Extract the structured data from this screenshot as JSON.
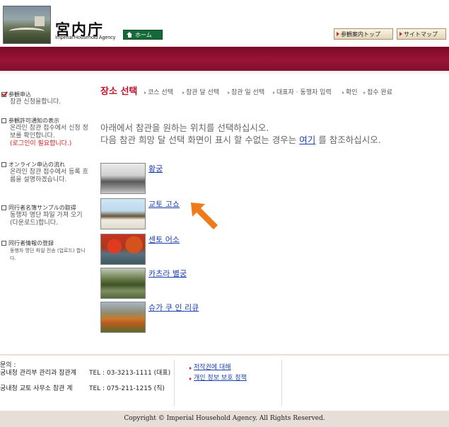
{
  "header": {
    "logo_title": "宮内庁",
    "logo_subtitle": "Imperial Household Agency",
    "home_label": "ホーム",
    "guide_top_label": "参観案内トップ",
    "sitemap_label": "サイトマップ",
    "banner_color": "#8a0f2e"
  },
  "sidebar": {
    "items": [
      {
        "heading": "参観申込",
        "desc": "참관 신청을합니다.",
        "checked": true
      },
      {
        "heading": "参観許可通知の表示",
        "desc": "온라인 참관 접수에서 신청 정보를 확인합니다.",
        "warn": "(로그인이 필요합니다.)"
      },
      {
        "heading": "オンライン申込の流れ",
        "desc": "온라인 참관 접수에서 등록 흐름을 설명하겠습니다."
      },
      {
        "heading": "同行者名簿サンプルの取得",
        "desc": "동행자 명단 파일 가져 오기 (다운로드)합니다."
      },
      {
        "heading": "同行者情報の登録",
        "desc": "동행자 명단 파일 전송 (업로드) 합니다."
      }
    ]
  },
  "steps": {
    "current": "장소 선택",
    "items": [
      "코스 선택",
      "참관 달 선택",
      "참관 일 선택",
      "대표자 · 동행자 입력",
      "확인",
      "접수 완료"
    ]
  },
  "intro": {
    "line1": "아래에서 참관을 원하는 위치를 선택하십시오.",
    "line2_pre": "다음 참관 희망 달 선택 화면이 표시 할 수없는 경우는 ",
    "line2_link": "여기",
    "line2_post": " 를 참조하십시오."
  },
  "sites": [
    {
      "name": "황궁",
      "icon": "imperial-palace-photo"
    },
    {
      "name": "교토 고쇼",
      "icon": "kyoto-gosho-photo"
    },
    {
      "name": "센토 어소",
      "icon": "sento-palace-photo"
    },
    {
      "name": "카츠라 별궁",
      "icon": "katsura-villa-photo"
    },
    {
      "name": "슈가 쿠 인 리큐",
      "icon": "shugakuin-villa-photo"
    }
  ],
  "footer": {
    "contact_label": "문의 :",
    "contact_rows": [
      {
        "left": "궁내청 관리부 관리과 참관계",
        "right": "TEL : 03-3213-1111 (대표)"
      },
      {
        "left": "궁내청 교토 사무소 참관 계",
        "right": "TEL : 075-211-1215 (직)"
      }
    ],
    "links": [
      "저작권에 대해",
      "개인 정보 보호 정책"
    ],
    "copyright": "Copyright © Imperial Household Agency. All Rights Reserved."
  },
  "accent_arrow_color": "#f07a1a"
}
